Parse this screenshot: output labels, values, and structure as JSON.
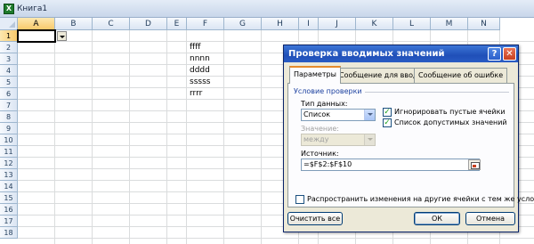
{
  "workbook": {
    "title": "Книга1"
  },
  "grid": {
    "columns": [
      "A",
      "B",
      "C",
      "D",
      "E",
      "F",
      "G",
      "H",
      "I",
      "J",
      "K",
      "L",
      "M",
      "N"
    ],
    "rows": [
      "1",
      "2",
      "3",
      "4",
      "5",
      "6",
      "7",
      "8",
      "9",
      "10",
      "11",
      "12",
      "13",
      "14",
      "15",
      "16",
      "17",
      "18"
    ],
    "selected_column": "A",
    "selected_row": "1",
    "column_f_values": [
      "ffff",
      "nnnn",
      "dddd",
      "sssss",
      "rrrr"
    ]
  },
  "dialog": {
    "title": "Проверка вводимых значений",
    "help_glyph": "?",
    "close_glyph": "✕",
    "tabs": [
      "Параметры",
      "Сообщение для ввода",
      "Сообщение об ошибке"
    ],
    "active_tab": "Параметры",
    "group_title": "Условие проверки",
    "data_type_label": "Тип данных:",
    "data_type_value": "Список",
    "value_label": "Значение:",
    "value_value": "между",
    "ignore_blank_label": "Игнорировать пустые ячейки",
    "ignore_blank_checked": true,
    "in_cell_dropdown_label": "Список допустимых значений",
    "in_cell_dropdown_checked": true,
    "source_label": "Источник:",
    "source_value": "=$F$2:$F$10",
    "apply_all_label": "Распространить изменения на другие ячейки с тем же условием",
    "apply_all_checked": false,
    "check_mark": "✓",
    "clear_all_label": "Очистить все",
    "ok_label": "ОК",
    "cancel_label": "Отмена"
  }
}
